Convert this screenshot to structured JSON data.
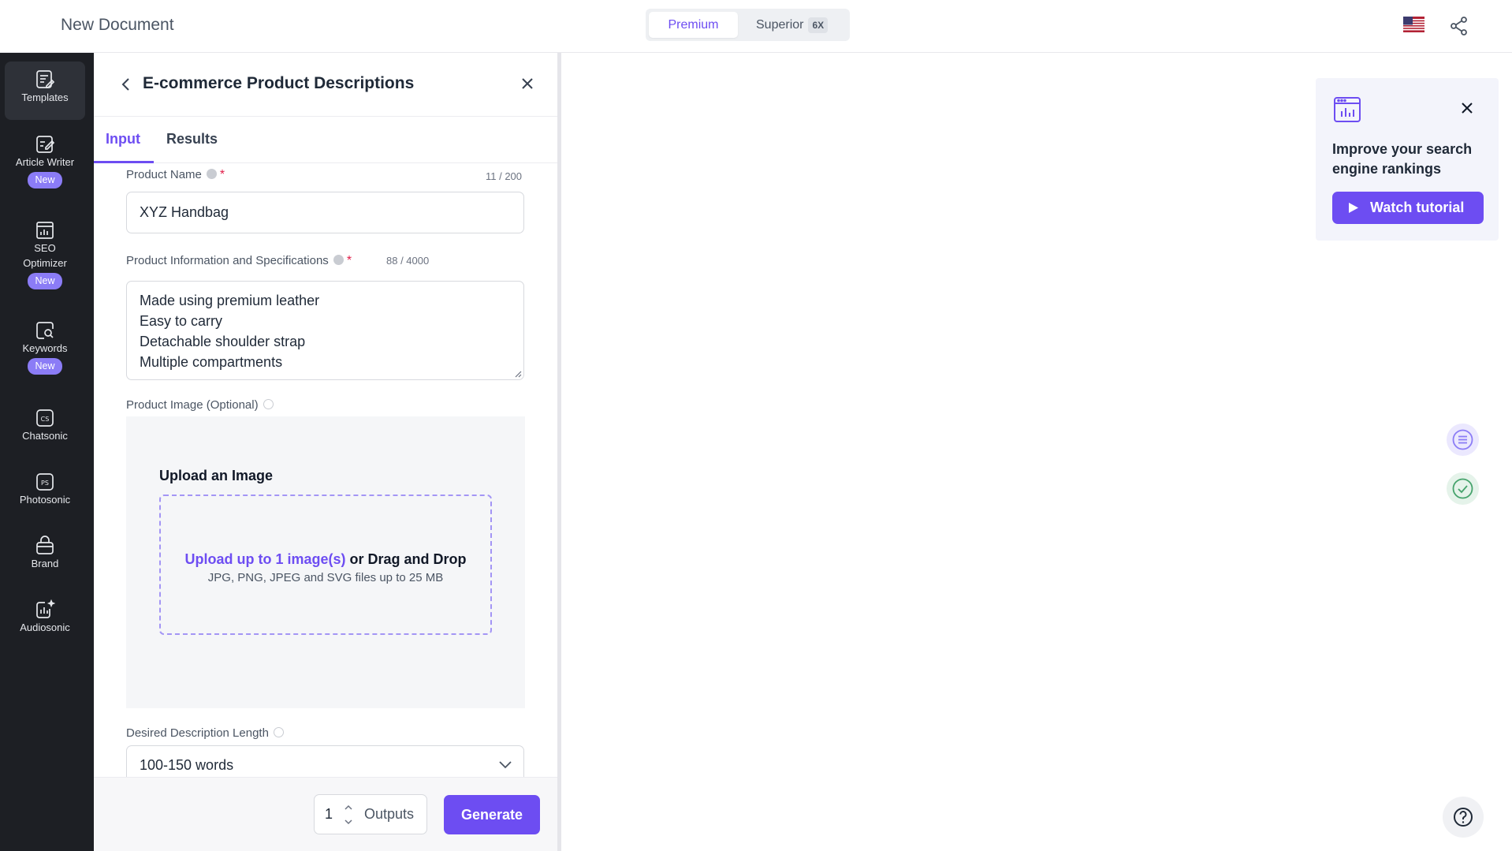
{
  "topbar": {
    "document_title": "New Document",
    "mode_premium": "Premium",
    "mode_superior": "Superior",
    "mode_superior_badge": "6X",
    "flag_icon": "us-flag-icon",
    "share_icon": "share-icon"
  },
  "sidebar": {
    "items": [
      {
        "label": "Templates",
        "icon": "templates-icon",
        "badge": ""
      },
      {
        "label": "Article Writer",
        "icon": "article-writer-icon",
        "badge": "New"
      },
      {
        "label_line1": "SEO",
        "label_line2": "Optimizer",
        "icon": "seo-optimizer-icon",
        "badge": "New"
      },
      {
        "label": "Keywords",
        "icon": "keywords-icon",
        "badge": "New"
      },
      {
        "label": "Chatsonic",
        "icon": "chatsonic-icon",
        "badge": ""
      },
      {
        "label": "Photosonic",
        "icon": "photosonic-icon",
        "badge": ""
      },
      {
        "label": "Brand",
        "icon": "brand-icon",
        "badge": ""
      },
      {
        "label": "Audiosonic",
        "icon": "audiosonic-icon",
        "badge": ""
      }
    ]
  },
  "panel": {
    "title": "E-commerce Product Descriptions",
    "tabs": [
      {
        "label": "Input",
        "active": true
      },
      {
        "label": "Results",
        "active": false
      }
    ],
    "product_name": {
      "label": "Product Name",
      "required_mark": "*",
      "counter": "11 / 200",
      "value": "XYZ Handbag"
    },
    "product_info": {
      "label": "Product Information and Specifications",
      "required_mark": "*",
      "counter": "88 / 4000",
      "lines": [
        "Made using premium leather",
        "Easy to carry",
        "Detachable shoulder strap",
        "Multiple compartments"
      ]
    },
    "product_image": {
      "label": "Product Image (Optional)",
      "upload_title": "Upload an Image",
      "upload_link": "Upload up to 1 image(s)",
      "upload_rest": " or Drag and Drop",
      "upload_hint": "JPG, PNG, JPEG and SVG files up to 25 MB"
    },
    "description_length": {
      "label": "Desired Description Length",
      "selected": "100-150 words"
    },
    "footer": {
      "outputs_value": "1",
      "outputs_label": "Outputs",
      "generate_label": "Generate"
    }
  },
  "tutorial": {
    "text": "Improve your search engine rankings",
    "button_label": "Watch tutorial"
  },
  "colors": {
    "accent": "#6d4df2",
    "sidebar_bg": "#1d1f24",
    "required": "#e11d48"
  }
}
